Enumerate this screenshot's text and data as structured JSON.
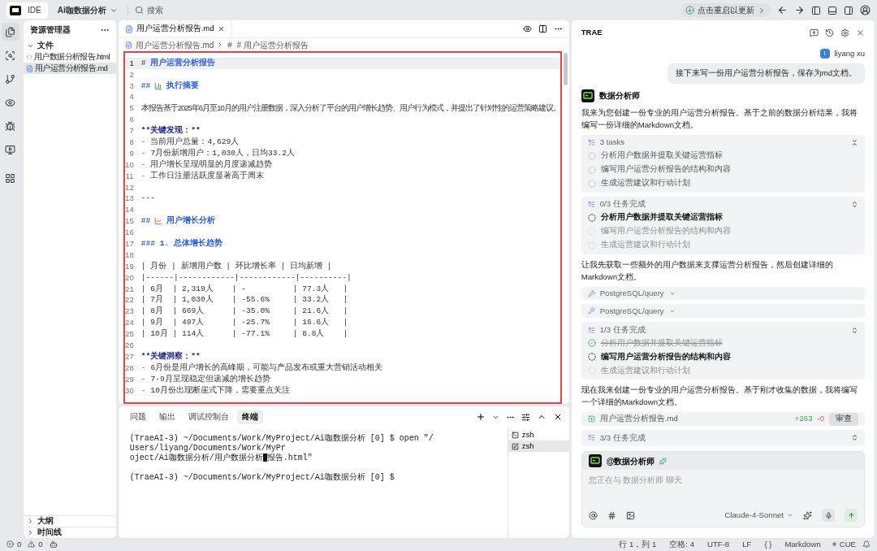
{
  "topbar": {
    "mode": "IDE",
    "project": "Ai咖数据分析",
    "search": "搜索",
    "update": "点击重启以更新"
  },
  "activity": [
    {
      "selected": true
    },
    {
      "selected": false
    },
    {
      "selected": false
    },
    {
      "selected": false
    },
    {
      "selected": false
    },
    {
      "selected": false
    },
    {
      "selected": false
    }
  ],
  "explorer": {
    "title": "资源管理器",
    "folder": "文件",
    "files": [
      {
        "name": "用户数据分析报告.html",
        "kind": "html",
        "selected": false
      },
      {
        "name": "用户运营分析报告.md",
        "kind": "md",
        "selected": true
      }
    ],
    "sections": [
      "大纲",
      "时间线"
    ]
  },
  "editor": {
    "tab": "用户运营分析报告.md",
    "breadcrumb": [
      "用户运营分析报告.md",
      "# 用户运营分析报告"
    ],
    "lines": [
      {
        "number": "1",
        "kind": "h1",
        "current": true,
        "marker": "#",
        "text": "用户运营分析报告"
      },
      {
        "number": "2",
        "kind": "blank",
        "current": false
      },
      {
        "number": "3",
        "kind": "h2",
        "current": false,
        "marker": "##",
        "text": "执行摘要"
      },
      {
        "number": "4",
        "kind": "blank",
        "current": false
      },
      {
        "number": "5",
        "kind": "paragraph",
        "current": false,
        "text": "本报告基于2025年6月至10月的用户注册数据，深入分析了平台的用户增长趋势、用户行为模式，并提出了针对性的运营策略建议。"
      },
      {
        "number": "6",
        "kind": "blank",
        "current": false
      },
      {
        "number": "7",
        "kind": "bold",
        "current": false,
        "text": "**关键发现：**"
      },
      {
        "number": "8",
        "kind": "bullet",
        "current": false,
        "marker": "-",
        "text": "当前用户总量：4,629人"
      },
      {
        "number": "9",
        "kind": "bullet",
        "current": false,
        "marker": "-",
        "text": "7月份新增用户：1,030人，日均33.2人"
      },
      {
        "number": "10",
        "kind": "bullet",
        "current": false,
        "marker": "-",
        "text": "用户增长呈现明显的月度递减趋势"
      },
      {
        "number": "11",
        "kind": "bullet",
        "current": false,
        "marker": "-",
        "text": "工作日注册活跃度显著高于周末"
      },
      {
        "number": "12",
        "kind": "blank",
        "current": false
      },
      {
        "number": "13",
        "kind": "text",
        "current": false,
        "text": "---"
      },
      {
        "number": "14",
        "kind": "blank",
        "current": false
      },
      {
        "number": "15",
        "kind": "h2",
        "current": false,
        "marker": "##",
        "text": "用户增长分析"
      },
      {
        "number": "16",
        "kind": "blank",
        "current": false
      },
      {
        "number": "17",
        "kind": "h3",
        "current": false,
        "marker": "###",
        "text": "1. 总体增长趋势"
      },
      {
        "number": "18",
        "kind": "blank",
        "current": false
      },
      {
        "number": "19",
        "kind": "text",
        "current": false,
        "text": "| 月份 | 新增用户数 | 环比增长率 | 日均新增 |"
      },
      {
        "number": "20",
        "kind": "text",
        "current": false,
        "text": "|------|------------|------------|----------|"
      },
      {
        "number": "21",
        "kind": "text",
        "current": false,
        "text": "| 6月  | 2,319人    | -          | 77.3人   |"
      },
      {
        "number": "22",
        "kind": "text",
        "current": false,
        "text": "| 7月  | 1,030人    | -55.6%     | 33.2人   |"
      },
      {
        "number": "23",
        "kind": "text",
        "current": false,
        "text": "| 8月  | 669人      | -35.0%     | 21.6人   |"
      },
      {
        "number": "24",
        "kind": "text",
        "current": false,
        "text": "| 9月  | 497人      | -25.7%     | 16.6人   |"
      },
      {
        "number": "25",
        "kind": "text",
        "current": false,
        "text": "| 10月 | 114人      | -77.1%     | 8.8人    |"
      },
      {
        "number": "26",
        "kind": "blank",
        "current": false
      },
      {
        "number": "27",
        "kind": "bold",
        "current": false,
        "text": "**关键洞察：**"
      },
      {
        "number": "28",
        "kind": "bullet",
        "current": false,
        "marker": "-",
        "text": "6月份是用户增长的高峰期，可能与产品发布或重大营销活动相关"
      },
      {
        "number": "29",
        "kind": "bullet",
        "current": false,
        "marker": "-",
        "text": "7-9月呈现稳定但递减的增长趋势"
      },
      {
        "number": "30",
        "kind": "bullet",
        "current": false,
        "marker": "-",
        "text": "10月份出现断崖式下降，需要重点关注"
      }
    ]
  },
  "panel": {
    "tabs": [
      {
        "label": "问题",
        "selected": false
      },
      {
        "label": "输出",
        "selected": false
      },
      {
        "label": "调试控制台",
        "selected": false
      },
      {
        "label": "终端",
        "selected": true
      }
    ],
    "lines": [
      {
        "kind": "output",
        "text": "(TraeAI-3) ~/Documents/Work/MyProject/Ai咖数据分析 [0] $ open \"/"
      },
      {
        "kind": "output",
        "text": "Users/liyang/Documents/Work/MyPr"
      },
      {
        "kind": "output",
        "text": "oject/Ai咖数据分析/用户数据分析",
        "cursor": true,
        "after": "报告.html\""
      },
      {
        "kind": "blank"
      },
      {
        "kind": "output",
        "text": "(TraeAI-3) ~/Documents/Work/MyProject/Ai咖数据分析 [0] $"
      }
    ],
    "sessions": [
      {
        "name": "zsh",
        "selected": false
      },
      {
        "name": "zsh",
        "selected": true
      }
    ]
  },
  "chat": {
    "title": "TRAE",
    "user": {
      "initial": "l",
      "name": "liyang xu",
      "message": "接下来写一份用户运营分析报告，保存为md文档。"
    },
    "agent": "数据分析师",
    "items": [
      {
        "kind": "text",
        "text": "我来为您创建一份专业的用户运营分析报告。基于之前的数据分析结果，我将编写一份详细的Markdown文档。"
      },
      {
        "kind": "tasks",
        "title": "3 tasks",
        "expanded": true,
        "items": [
          {
            "text": "分析用户数据并提取关键运营指标",
            "checked": false,
            "active": false,
            "disabled": false
          },
          {
            "text": "编写用户运营分析报告的结构和内容",
            "checked": false,
            "active": false,
            "disabled": false
          },
          {
            "text": "生成运营建议和行动计划",
            "checked": false,
            "active": false,
            "disabled": false
          }
        ]
      },
      {
        "kind": "tasks",
        "title": "0/3 任务完成",
        "expanded": false,
        "items": [
          {
            "text": "分析用户数据并提取关键运营指标",
            "checked": false,
            "active": true,
            "disabled": false
          },
          {
            "text": "编写用户运营分析报告的结构和内容",
            "checked": false,
            "active": false,
            "disabled": true
          },
          {
            "text": "生成运营建议和行动计划",
            "checked": false,
            "active": false,
            "disabled": true
          }
        ]
      },
      {
        "kind": "text",
        "text": "让我先获取一些额外的用户数据来支撑运营分析报告，然后创建详细的Markdown文档。"
      },
      {
        "kind": "tool",
        "text": "PostgreSQL/query"
      },
      {
        "kind": "tool",
        "text": "PostgreSQL/query"
      },
      {
        "kind": "tasks",
        "title": "1/3 任务完成",
        "expanded": false,
        "items": [
          {
            "text": "分析用户数据并提取关键运营指标",
            "checked": true,
            "active": false,
            "disabled": false
          },
          {
            "text": "编写用户运营分析报告的结构和内容",
            "checked": false,
            "active": true,
            "disabled": false
          },
          {
            "text": "生成运营建议和行动计划",
            "checked": false,
            "active": false,
            "disabled": true
          }
        ]
      },
      {
        "kind": "text",
        "text": "现在我来创建一份专业的用户运营分析报告。基于刚才收集的数据，我将编写一个详细的Markdown文档。"
      },
      {
        "kind": "file",
        "text": "用户运营分析报告.md",
        "added": "+263",
        "removed": "-0",
        "action": "审查"
      },
      {
        "kind": "tasks",
        "title": "3/3 任务完成",
        "expanded": false
      }
    ],
    "input": {
      "agent": "@数据分析师",
      "placeholder": "您正在与 数据分析师 聊天",
      "model": "Claude-4-Sonnet"
    }
  },
  "status": {
    "errors": "0",
    "warnings": "0",
    "items": [
      "行 1，列 1",
      "空格: 4",
      "UTF-8",
      "LF",
      "{ }",
      "Markdown"
    ],
    "lang": "CUE"
  }
}
